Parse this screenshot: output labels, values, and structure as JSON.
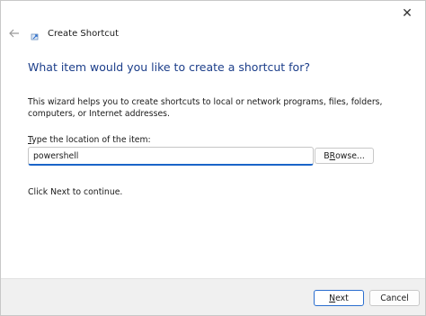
{
  "window": {
    "title": "Create Shortcut",
    "close_glyph": "✕"
  },
  "main": {
    "heading": "What item would you like to create a shortcut for?",
    "description": "This wizard helps you to create shortcuts to local or network programs, files, folders, computers, or Internet addresses.",
    "location_label_mnemonic": "T",
    "location_label_rest": "ype the location of the item:",
    "location_value": "powershell",
    "browse_label_mnemonic": "R",
    "browse_label_rest": "owse...",
    "browse_label_prefix": "B",
    "instruction": "Click Next to continue."
  },
  "footer": {
    "next_mnemonic": "N",
    "next_rest": "ext",
    "cancel_label": "Cancel"
  },
  "icons": {
    "back": "back-arrow-icon",
    "app": "shortcut-wizard-icon",
    "close": "close-icon"
  },
  "colors": {
    "heading": "#1c3e8a",
    "focus_accent": "#1a64c8",
    "footer_bg": "#f0f0f0"
  }
}
